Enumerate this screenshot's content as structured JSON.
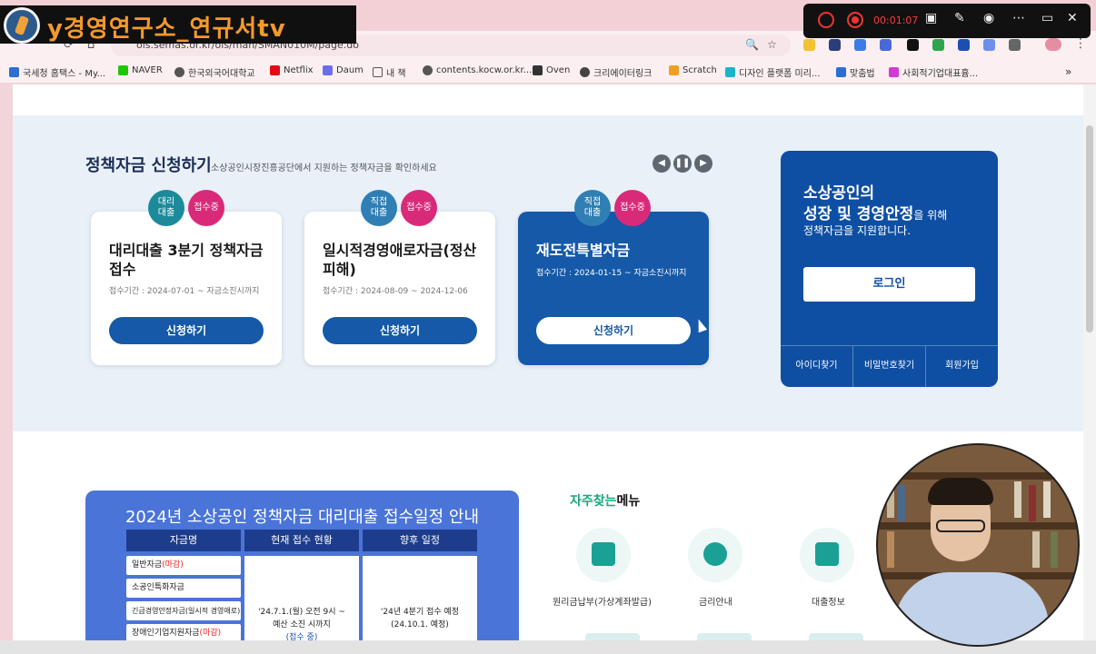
{
  "channel": {
    "title": "y경영연구소_연규서tv"
  },
  "recorder": {
    "time": "00:01:07"
  },
  "browser": {
    "url": "ols.semas.or.kr/ols/man/SMAN010M/page.do",
    "bookmarks": [
      "국세청 홈택스 - My...",
      "NAVER",
      "한국외국어대학교",
      "Netflix",
      "Daum",
      "내 책",
      "contents.kocw.or.kr...",
      "Oven",
      "크리에이터링크",
      "Scratch",
      "디자인 플랫폼 미리...",
      "맞춤법",
      "사회적기업대표흄..."
    ],
    "colors": {
      "tab_bg": "#f3d0d6"
    }
  },
  "policy": {
    "title": "정책자금 신청하기",
    "subtitle": "소상공인시장진흥공단에서 지원하는 정책자금을 확인하세요",
    "cards": [
      {
        "badge_type": "대리\n대출",
        "badge_status": "접수중",
        "title": "대리대출 3분기 정책자금 접수",
        "period": "접수기간 : 2024-07-01 ~ 자금소진시까지",
        "button": "신청하기"
      },
      {
        "badge_type": "직접\n대출",
        "badge_status": "접수중",
        "title": "일시적경영애로자금(정산피해)",
        "period": "접수기간 : 2024-08-09 ~ 2024-12-06",
        "button": "신청하기"
      },
      {
        "badge_type": "직접\n대출",
        "badge_status": "접수중",
        "title": "재도전특별자금",
        "period": "접수기간 : 2024-01-15 ~ 자금소진시까지",
        "button": "신청하기"
      }
    ]
  },
  "login_panel": {
    "line1": "소상공인의",
    "line2_bold": "성장 및 경영안정",
    "line2_rest": "을 위해",
    "line3": "정책자금을 지원합니다.",
    "login_button": "로그인",
    "links": [
      "아이디찾기",
      "비밀번호찾기",
      "회원가입"
    ]
  },
  "schedule": {
    "title": "2024년 소상공인 정책자금 대리대출 접수일정 안내",
    "columns": [
      "자금명",
      "현재 접수 현황",
      "향후 일정"
    ],
    "items": [
      {
        "name": "일반자금",
        "note": "(마감)"
      },
      {
        "name": "소공인특화자금",
        "note": ""
      },
      {
        "name": "긴급경영안정자금(일시적 경영애로)",
        "note": ""
      },
      {
        "name": "장애인기업지원자금",
        "note": "(마감)"
      }
    ],
    "current_line1": "'24.7.1.(월) 오전 9시 ~",
    "current_line2": "예산 소진 시까지",
    "current_line3": "(접수 중)",
    "future_line1": "'24년 4분기 접수 예정",
    "future_line2": "(24.10.1. 예정)"
  },
  "favorites": {
    "title_green": "자주찾는",
    "title_dark": "메뉴",
    "items": [
      "원리금납부(가상계좌발급)",
      "금리안내",
      "대출정보"
    ]
  }
}
